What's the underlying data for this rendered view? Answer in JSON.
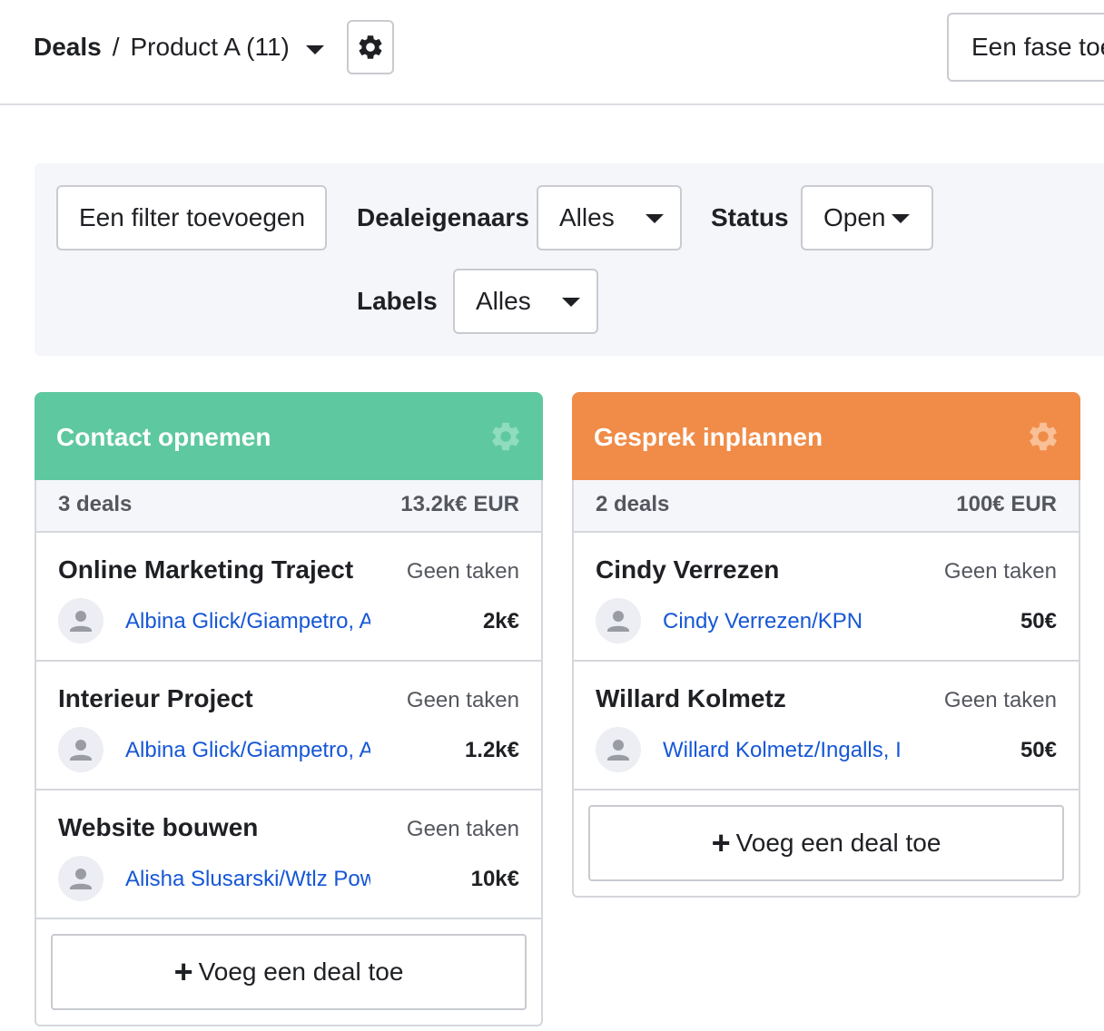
{
  "header": {
    "breadcrumb_root": "Deals",
    "breadcrumb_separator": "/",
    "pipeline_name": "Product A (11)",
    "add_stage_label": "Een fase toe"
  },
  "filters": {
    "add_filter_label": "Een filter toevoegen",
    "owners_label": "Dealeigenaars",
    "owners_value": "Alles",
    "status_label": "Status",
    "status_value": "Open",
    "labels_label": "Labels",
    "labels_value": "Alles"
  },
  "columns": [
    {
      "title": "Contact opnemen",
      "color": "#5ec8a0",
      "count": "3 deals",
      "total": "13.2k€ EUR",
      "cards": [
        {
          "title": "Online Marketing Traject",
          "tasks": "Geen taken",
          "contact": "Albina Glick/Giampetro, A",
          "amount": "2k€"
        },
        {
          "title": "Interieur Project",
          "tasks": "Geen taken",
          "contact": "Albina Glick/Giampetro, A",
          "amount": "1.2k€"
        },
        {
          "title": "Website bouwen",
          "tasks": "Geen taken",
          "contact": "Alisha Slusarski/Wtlz Pow",
          "amount": "10k€"
        }
      ],
      "add_deal_label": "Voeg een deal toe"
    },
    {
      "title": "Gesprek inplannen",
      "color": "#f08c48",
      "count": "2 deals",
      "total": "100€ EUR",
      "cards": [
        {
          "title": "Cindy Verrezen",
          "tasks": "Geen taken",
          "contact": "Cindy Verrezen/KPN",
          "amount": "50€"
        },
        {
          "title": "Willard Kolmetz",
          "tasks": "Geen taken",
          "contact": "Willard Kolmetz/Ingalls, I",
          "amount": "50€"
        }
      ],
      "add_deal_label": "Voeg een deal toe"
    }
  ],
  "icons": {
    "settings": "gear-icon",
    "dropdown": "chevron-down-icon",
    "avatar": "user-icon",
    "add": "plus-icon"
  }
}
